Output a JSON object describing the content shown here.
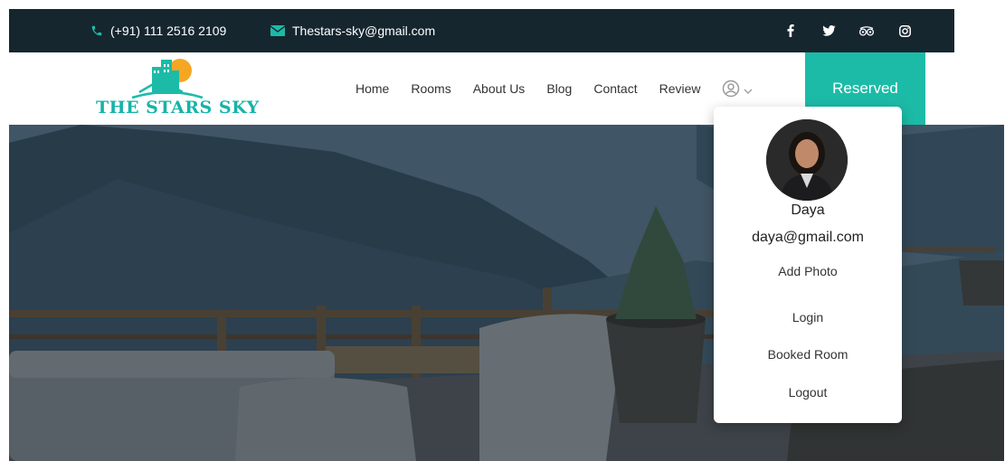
{
  "topbar": {
    "phone": "(+91) 111 2516 2109",
    "email": "Thestars-sky@gmail.com",
    "icons": [
      "phone-icon",
      "mail-icon",
      "facebook-icon",
      "twitter-icon",
      "tripadvisor-icon",
      "instagram-icon"
    ]
  },
  "brand": {
    "name": "THE STARS SKY"
  },
  "nav": {
    "items": [
      {
        "label": "Home"
      },
      {
        "label": "Rooms"
      },
      {
        "label": "About Us"
      },
      {
        "label": "Blog"
      },
      {
        "label": "Contact"
      },
      {
        "label": "Review"
      }
    ],
    "user_icon": "user-circle-icon",
    "reserved_label": "Reserved"
  },
  "user_menu": {
    "name": "Daya",
    "email": "daya@gmail.com",
    "items": [
      {
        "label": "Add Photo"
      },
      {
        "label": "Login"
      },
      {
        "label": "Booked Room"
      },
      {
        "label": "Logout"
      }
    ]
  },
  "colors": {
    "topbar_bg": "#16262f",
    "accent": "#1cbba7",
    "brand_text": "#16b3a8",
    "logo_sun": "#f5a623"
  }
}
